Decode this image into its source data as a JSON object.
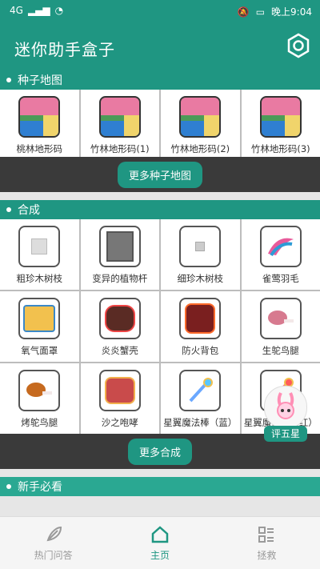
{
  "status": {
    "left": "4G",
    "time": "晚上9:04"
  },
  "app": {
    "title": "迷你助手盒子"
  },
  "sections": {
    "seeds": {
      "title": "种子地图",
      "more": "更多种子地图"
    },
    "craft": {
      "title": "合成",
      "more": "更多合成"
    },
    "newbie": {
      "title": "新手必看"
    }
  },
  "seeds": [
    {
      "label": "桃林地形码"
    },
    {
      "label": "竹林地形码(1)"
    },
    {
      "label": "竹林地形码(2)"
    },
    {
      "label": "竹林地形码(3)"
    }
  ],
  "craft_rows": [
    [
      "粗珍木树枝",
      "变异的植物杆",
      "细珍木树枝",
      "雀莺羽毛"
    ],
    [
      "氧气面罩",
      "炎炎蟹壳",
      "防火背包",
      "生鸵鸟腿"
    ],
    [
      "烤鸵鸟腿",
      "沙之咆哮",
      "星翼魔法棒（蓝）",
      "星翼魔法棒（红）"
    ]
  ],
  "floating": {
    "label": "评五星"
  },
  "tabs": [
    {
      "label": "热门问答",
      "icon": "leaf-icon"
    },
    {
      "label": "主页",
      "icon": "home-icon"
    },
    {
      "label": "拯救",
      "icon": "list-icon"
    }
  ],
  "colors": {
    "primary": "#1f9682",
    "band": "#3a3a3a"
  }
}
